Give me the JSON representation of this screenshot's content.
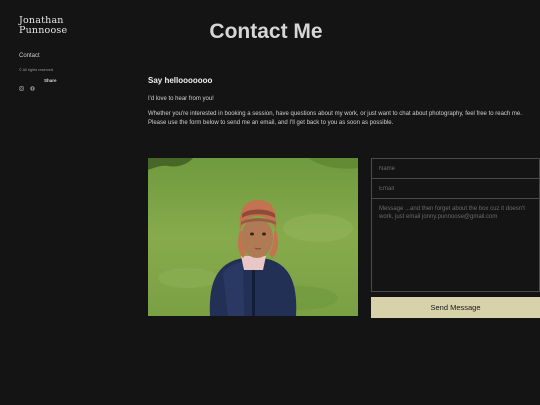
{
  "sidebar": {
    "brand_line1": "Jonathan",
    "brand_line2": "Punnoose",
    "nav_contact": "Contact",
    "copyright": "© All rights reserved",
    "share": "Share",
    "icons": [
      "instagram-icon",
      "facebook-icon"
    ]
  },
  "main": {
    "title": "Contact Me",
    "heading": "Say hellooooooo",
    "paragraph1": "I'd love to hear from you!",
    "paragraph2": "Whether you're interested in booking a session, have questions about my work, or just want to chat about photography, feel free to reach me. Please use the form below to send me an email, and I'll get back to you as soon as possible."
  },
  "form": {
    "name_placeholder": "Name",
    "email_placeholder": "Email",
    "message_placeholder": "Message ...and then forget about the box cuz it doesn't work, just email jonny.punnoose@gmail.com",
    "send_label": "Send Message"
  },
  "colors": {
    "background": "#141414",
    "button": "#d8d2aa",
    "field_border": "#4a4a4a"
  }
}
